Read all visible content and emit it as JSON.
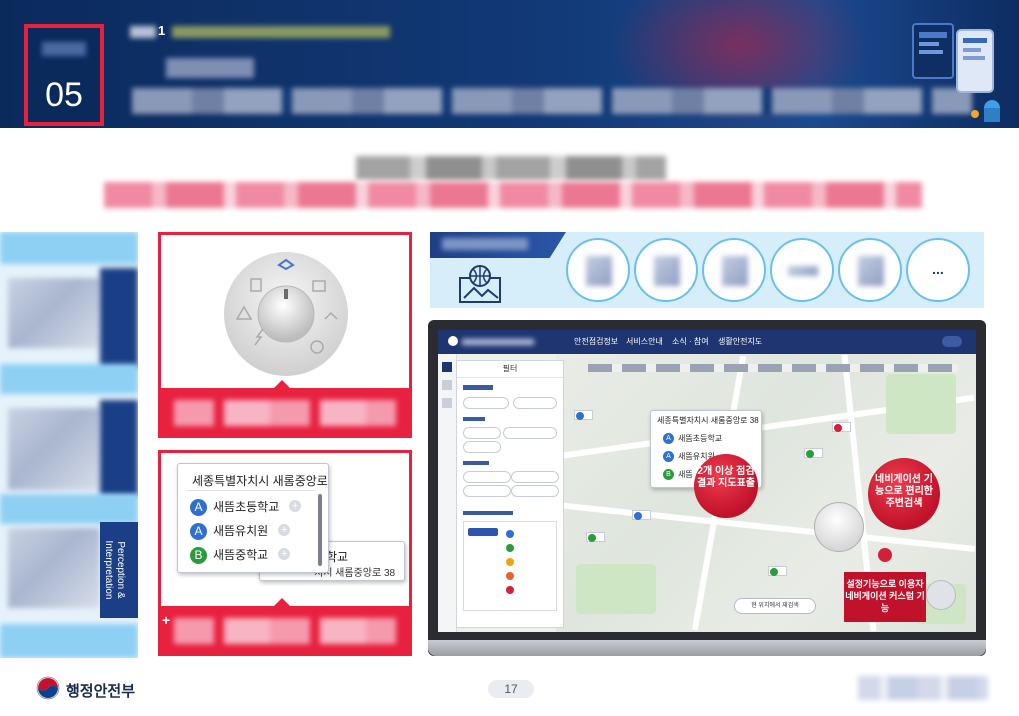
{
  "header": {
    "chapter_number": "05",
    "breadcrumb_number": "1"
  },
  "dial_panel": {},
  "list_panel": {
    "popup_title": "세종특별자치시 새롬중앙로",
    "items": [
      {
        "badge": "A",
        "label": "새뜸초등학교"
      },
      {
        "badge": "A",
        "label": "새뜸유치원"
      },
      {
        "badge": "B",
        "label": "새뜸중학교"
      }
    ],
    "back_card_title": "학교",
    "back_card_address": "치시 새롬중앙로 38",
    "plus_mark": "+"
  },
  "side_label": "Perception & Interpretation",
  "banner": {
    "more_label": "..."
  },
  "screenshot": {
    "nav_items": [
      "안전점검정보",
      "서비스안내",
      "소식 · 참여",
      "생활안전지도"
    ],
    "filter_title": "필터",
    "popup_title": "세종특별자치시 새롬중앙로 38",
    "popup_items": [
      {
        "badge": "A",
        "label": "새뜸초등학교"
      },
      {
        "badge": "A",
        "label": "새뜸유치원"
      },
      {
        "badge": "B",
        "label": "새뜸"
      }
    ],
    "callout_results": "2개 이상 점검결과 지도표출",
    "callout_navigation": "네비게이션 기능으로 편리한 주변검색",
    "callout_settings": "설정기능으로 이용자 네비게이션 커스텀 기능",
    "search_button": "현 위치에서 재검색"
  },
  "footer": {
    "org_name": "행정안전부",
    "page_number": "17"
  },
  "colors": {
    "navy": "#0b2a5c",
    "accent_red": "#e8213f",
    "light_blue": "#d6eefa"
  }
}
